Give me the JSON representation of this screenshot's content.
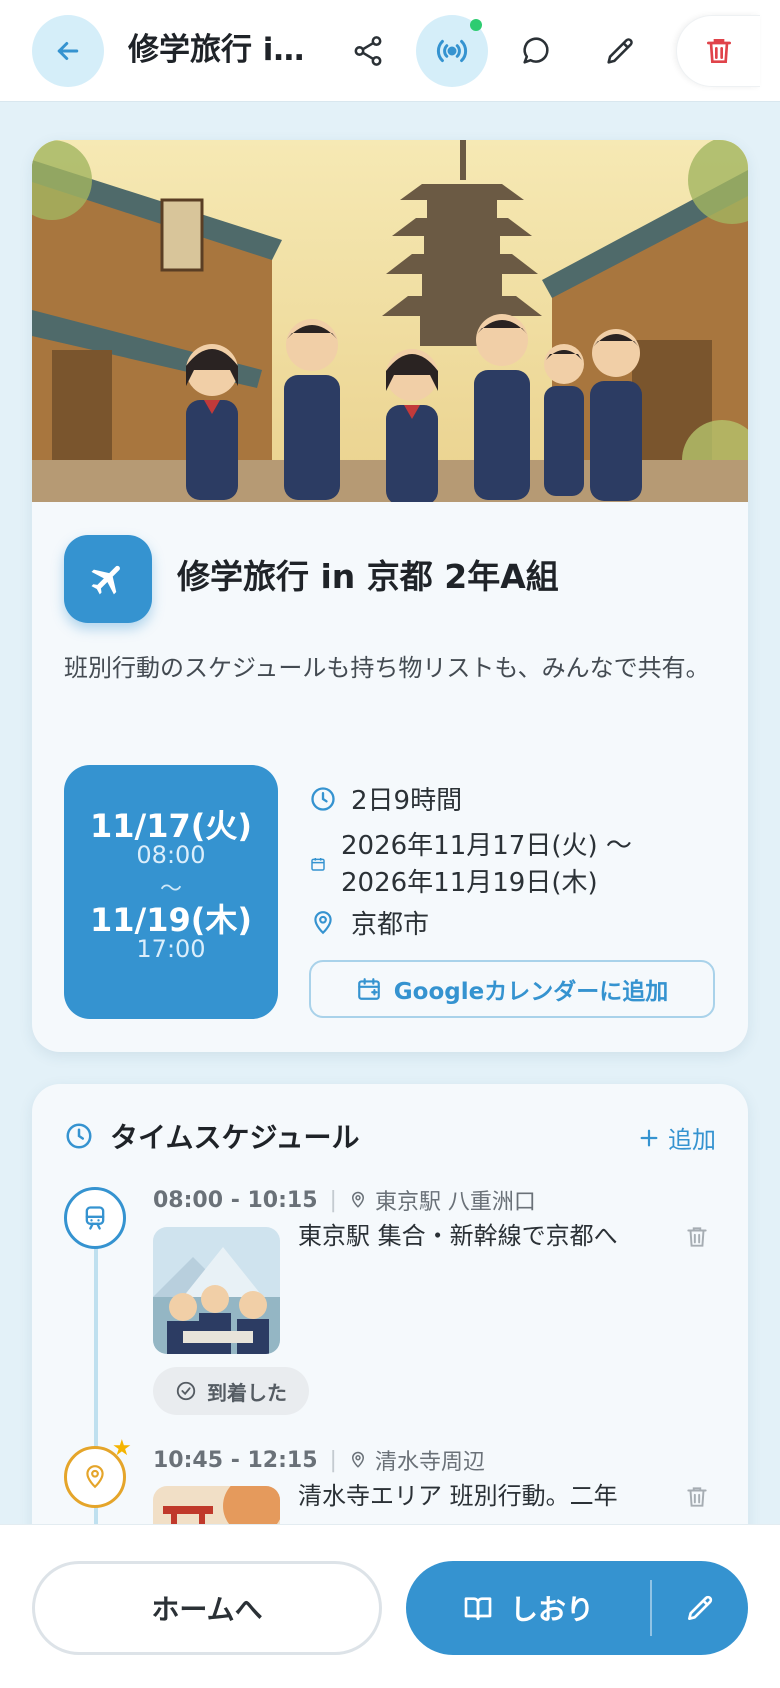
{
  "header": {
    "title": "修学旅行 i…",
    "back_icon": "arrow-left-icon",
    "actions": [
      "share-icon",
      "broadcast-icon",
      "comment-icon",
      "pencil-icon",
      "trash-icon"
    ],
    "live_indicator_color": "#2ecc71"
  },
  "event": {
    "title": "修学旅行 in 京都 2年A組",
    "description": "班別行動のスケジュールも持ち物リストも、みんなで共有。",
    "start_date": "11/17(火)",
    "start_time": "08:00",
    "range_sep": "〜",
    "end_date": "11/19(木)",
    "end_time": "17:00",
    "duration": "2日9時間",
    "date_range_line1": "2026年11月17日(火) 〜",
    "date_range_line2": "2026年11月19日(木)",
    "location": "京都市",
    "gcal_label": "Googleカレンダーに追加"
  },
  "schedule": {
    "heading": "タイムスケジュール",
    "add_label": "追加",
    "items": [
      {
        "time": "08:00 - 10:15",
        "location": "東京駅 八重洲口",
        "title": "東京駅 集合・新幹線で京都へ",
        "status": "到着した"
      },
      {
        "time": "10:45 - 12:15",
        "location": "清水寺周辺",
        "title": "清水寺エリア 班別行動。二年"
      }
    ]
  },
  "footer": {
    "home_label": "ホームへ",
    "shiori_label": "しおり"
  },
  "colors": {
    "accent": "#3593d0",
    "accent_light": "#d5eef9",
    "warning": "#e5a52a",
    "danger": "#e0434a"
  }
}
